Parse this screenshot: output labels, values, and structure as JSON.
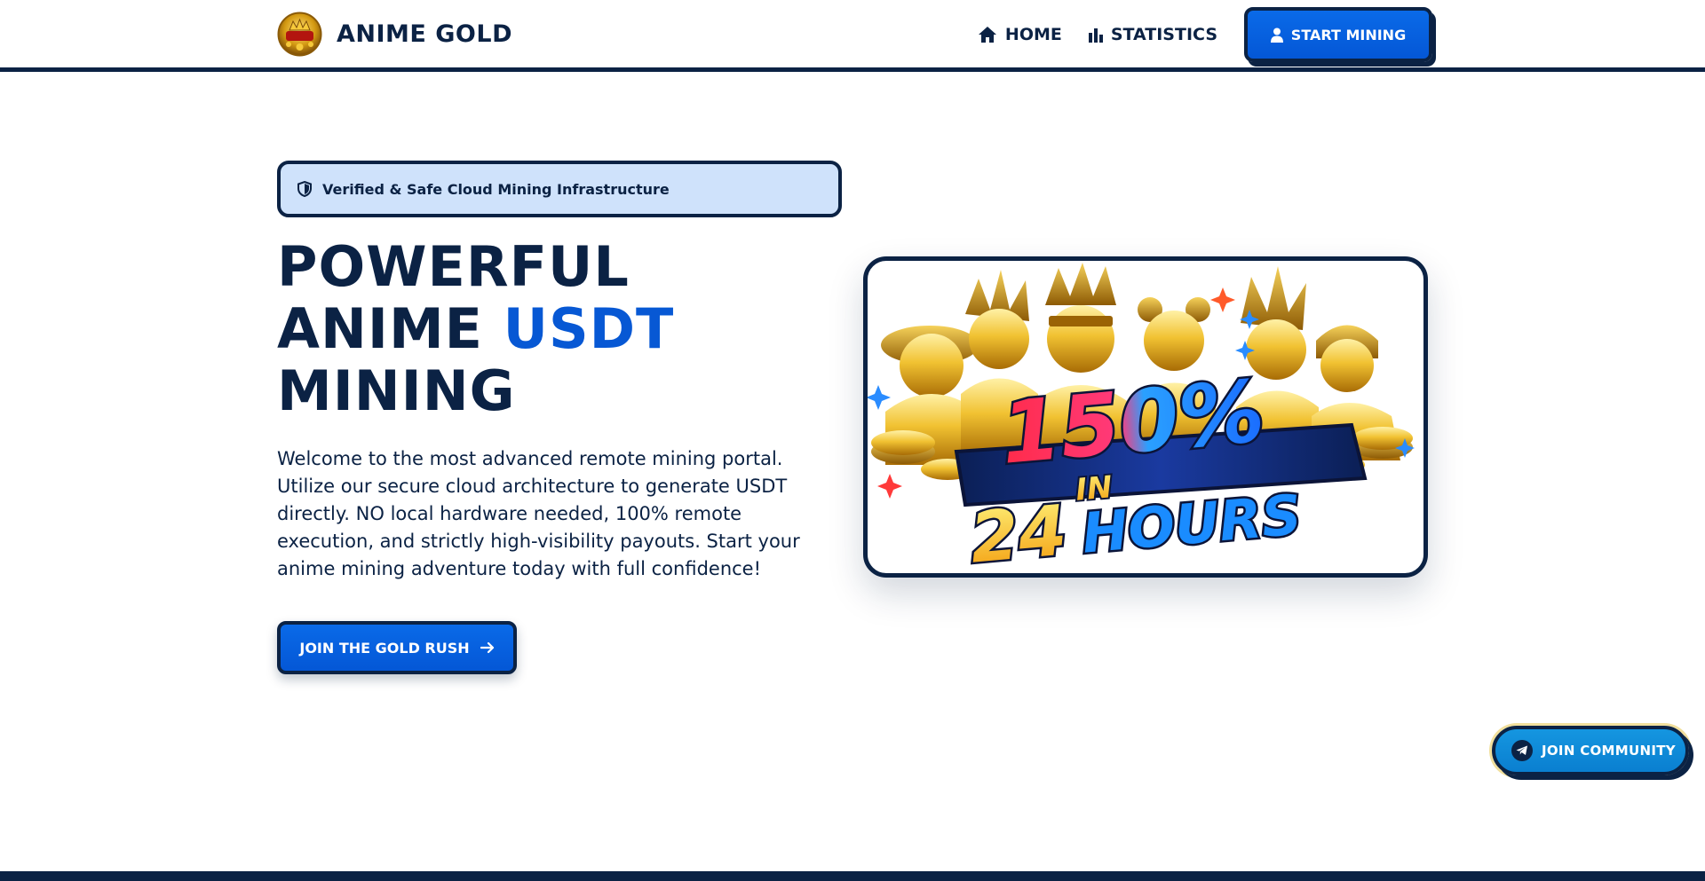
{
  "brand": {
    "name": "ANIME GOLD",
    "logo_text": "ANIME GOLD"
  },
  "nav": {
    "home": "HOME",
    "statistics": "STATISTICS",
    "start_mining": "START MINING"
  },
  "hero": {
    "badge": "Verified & Safe Cloud Mining Infrastructure",
    "title_line1": "POWERFUL",
    "title_line2_a": "ANIME",
    "title_line2_b": "USDT",
    "title_line3": "MINING",
    "description": "Welcome to the most advanced remote mining portal. Utilize our secure cloud architecture to generate USDT directly. NO local hardware needed, 100% remote execution, and strictly high-visibility payouts. Start your anime mining adventure today with full confidence!",
    "cta": "JOIN THE GOLD RUSH"
  },
  "promo": {
    "percent": "150%",
    "in": "IN",
    "hours_num": "24",
    "hours_word": "HOURS"
  },
  "community": {
    "label": "JOIN COMMUNITY"
  },
  "colors": {
    "navy": "#0b2244",
    "blue": "#0758d4",
    "badge_bg": "#cfe2fb",
    "telegram": "#0a7fd0",
    "gold": "#e0a800"
  },
  "icons": {
    "home": "home-icon",
    "statistics": "bar-chart-icon",
    "start_mining": "user-icon",
    "badge": "shield-icon",
    "cta": "arrow-right-icon",
    "community": "telegram-icon"
  }
}
